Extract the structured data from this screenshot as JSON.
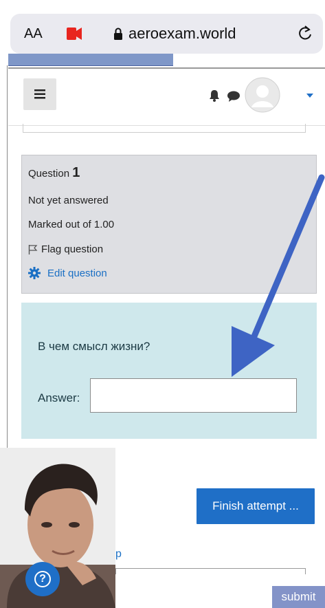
{
  "browser": {
    "text_size_label": "AA",
    "domain": "aeroexam.world"
  },
  "question_info": {
    "question_word": "Question",
    "question_number": "1",
    "status": "Not yet answered",
    "marked_out": "Marked out of 1.00",
    "flag_label": "Flag question",
    "edit_label": "Edit question"
  },
  "question": {
    "prompt": "В чем смысл жизни?",
    "answer_label": "Answer:",
    "answer_value": ""
  },
  "actions": {
    "finish_label": "Finish attempt ...",
    "link_fragment": "p",
    "submit_label": "submit"
  },
  "colors": {
    "primary": "#1f6fc7",
    "annotation_arrow": "#3e64c4",
    "question_info_bg": "#dedfe3",
    "question_text_bg": "#cfe8ec"
  },
  "icons": {
    "hamburger": "hamburger-icon",
    "bell": "bell-icon",
    "chat": "chat-icon",
    "avatar": "avatar",
    "dropdown": "caret-down-icon",
    "flag": "flag-icon",
    "edit": "gear-icon",
    "help": "help-icon"
  }
}
